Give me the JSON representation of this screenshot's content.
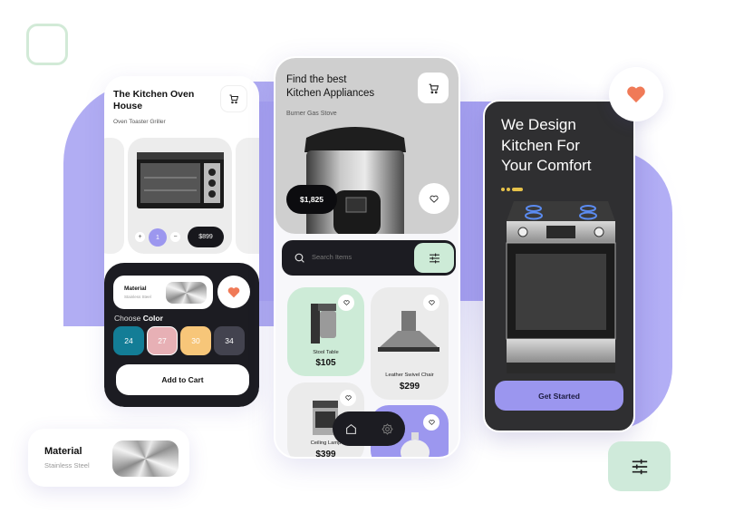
{
  "colors": {
    "accent_purple": "#9c97ef",
    "mint": "#cdebd7",
    "dark": "#1c1c22",
    "heart": "#f07a57"
  },
  "phone_left": {
    "title": "The Kitchen Oven House",
    "subtitle": "Oven Toaster Griller",
    "cart_icon": "cart-icon",
    "product": {
      "quantity_plus": "+",
      "quantity": "1",
      "quantity_minus": "−",
      "price": "$899"
    },
    "material": {
      "label": "Material",
      "value": "Stainless Steel"
    },
    "choose_color_prefix": "Choose",
    "choose_color_bold": "Color",
    "color_options": [
      {
        "label": "24",
        "color": "#137d96"
      },
      {
        "label": "27",
        "color": "#e7b0b5"
      },
      {
        "label": "30",
        "color": "#f7c679"
      },
      {
        "label": "34",
        "color": "#43434f"
      }
    ],
    "add_to_cart": "Add to Cart"
  },
  "phone_middle": {
    "title_line1": "Find the best",
    "title_line2": "Kitchen Appliances",
    "subtitle": "Burner Gas Stove",
    "price": "$1,825",
    "search_placeholder": "Search Items",
    "products": [
      {
        "name": "Stool Table",
        "price": "$105",
        "bg": "#cdebd7"
      },
      {
        "name": "Leather Swivel Chair",
        "price": "$299",
        "bg": "#ebebeb"
      },
      {
        "name": "Ceiling Lamp",
        "price": "$399",
        "bg": "#ebebeb"
      },
      {
        "name": "",
        "price": "",
        "bg": "#9c97ef"
      }
    ],
    "nav": [
      "home-icon",
      "settings-icon"
    ]
  },
  "phone_right": {
    "title_line1": "We Design",
    "title_line2": "Kitchen For",
    "title_line3": "Your Comfort",
    "cta": "Get Started"
  },
  "material_card": {
    "label": "Material",
    "value": "Stainless Steel"
  }
}
